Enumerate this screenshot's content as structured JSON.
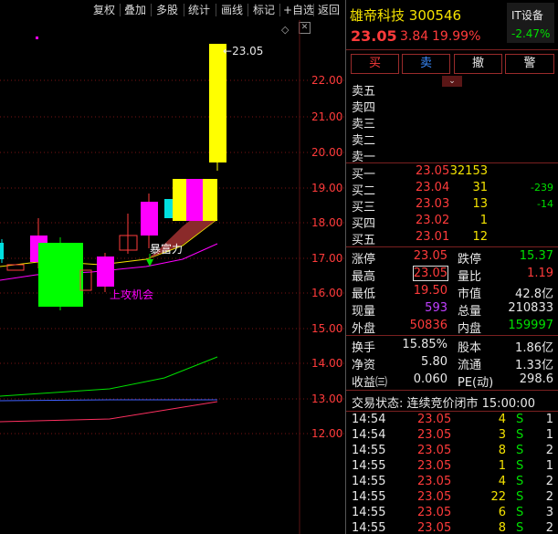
{
  "toolbar": {
    "items": [
      "复权",
      "叠加",
      "多股",
      "统计",
      "画线",
      "标记",
      "+自选",
      "返回"
    ]
  },
  "chart": {
    "y_ticks": [
      "22.00",
      "21.00",
      "20.00",
      "19.00",
      "18.00",
      "17.00",
      "16.00",
      "15.00",
      "14.00",
      "13.00",
      "12.00"
    ],
    "high_label": "23.05",
    "annotations": {
      "sign": "暴富力",
      "opportunity": "上攻机会"
    }
  },
  "header": {
    "name": "雄帝科技",
    "code": "300546",
    "sector": "IT设备",
    "sector_change": "-2.47%",
    "price": "23.05",
    "change": "3.84",
    "pct": "19.99%"
  },
  "actions": {
    "buy": "买",
    "sell": "卖",
    "cancel": "撤",
    "alert": "警"
  },
  "sell_book": [
    {
      "label": "卖五"
    },
    {
      "label": "卖四"
    },
    {
      "label": "卖三"
    },
    {
      "label": "卖二"
    },
    {
      "label": "卖一"
    }
  ],
  "buy_book": [
    {
      "label": "买一",
      "price": "23.05",
      "vol": "32153",
      "diff": ""
    },
    {
      "label": "买二",
      "price": "23.04",
      "vol": "31",
      "diff": "-239"
    },
    {
      "label": "买三",
      "price": "23.03",
      "vol": "13",
      "diff": "-14"
    },
    {
      "label": "买四",
      "price": "23.02",
      "vol": "1",
      "diff": ""
    },
    {
      "label": "买五",
      "price": "23.01",
      "vol": "12",
      "diff": ""
    }
  ],
  "stats": {
    "limit_up_label": "涨停",
    "limit_up": "23.05",
    "limit_down_label": "跌停",
    "limit_down": "15.37",
    "high_label": "最高",
    "high": "23.05",
    "vol_ratio_label": "量比",
    "vol_ratio": "1.19",
    "low_label": "最低",
    "low": "19.50",
    "mkt_cap_label": "市值",
    "mkt_cap": "42.8亿",
    "cur_vol_label": "现量",
    "cur_vol": "593",
    "total_vol_label": "总量",
    "total_vol": "210833",
    "outer_label": "外盘",
    "outer": "50836",
    "inner_label": "内盘",
    "inner": "159997",
    "turnover_label": "换手",
    "turnover": "15.85%",
    "equity_label": "股本",
    "equity": "1.86亿",
    "nav_label": "净资",
    "nav": "5.80",
    "float_label": "流通",
    "float": "1.33亿",
    "eps_label": "收益㈢",
    "eps": "0.060",
    "pe_label": "PE(动)",
    "pe": "298.6"
  },
  "status_line": "交易状态: 连续竞价闭市 15:00:00",
  "ticks": [
    {
      "time": "14:54",
      "price": "23.05",
      "vol": "4",
      "side": "S",
      "n": "1"
    },
    {
      "time": "14:54",
      "price": "23.05",
      "vol": "3",
      "side": "S",
      "n": "1"
    },
    {
      "time": "14:55",
      "price": "23.05",
      "vol": "8",
      "side": "S",
      "n": "2"
    },
    {
      "time": "14:55",
      "price": "23.05",
      "vol": "1",
      "side": "S",
      "n": "1"
    },
    {
      "time": "14:55",
      "price": "23.05",
      "vol": "4",
      "side": "S",
      "n": "2"
    },
    {
      "time": "14:55",
      "price": "23.05",
      "vol": "22",
      "side": "S",
      "n": "2"
    },
    {
      "time": "14:55",
      "price": "23.05",
      "vol": "6",
      "side": "S",
      "n": "3"
    },
    {
      "time": "14:55",
      "price": "23.05",
      "vol": "8",
      "side": "S",
      "n": "2"
    }
  ],
  "colors": {
    "up": "#ff3b3b",
    "down": "#00e000",
    "hi": "#f5e300",
    "ma": "#ff00ff"
  }
}
